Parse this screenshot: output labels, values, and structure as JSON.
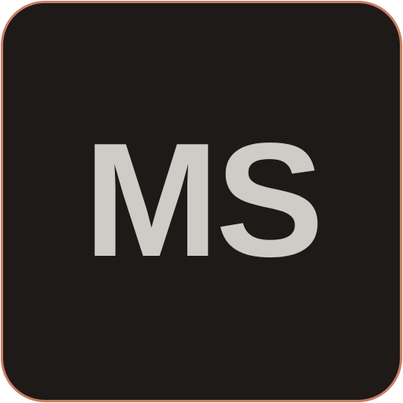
{
  "icon": {
    "monogram": "MS",
    "colors": {
      "background": "#1d1a17",
      "border": "#c97d62",
      "text": "#cfcbc7"
    }
  }
}
